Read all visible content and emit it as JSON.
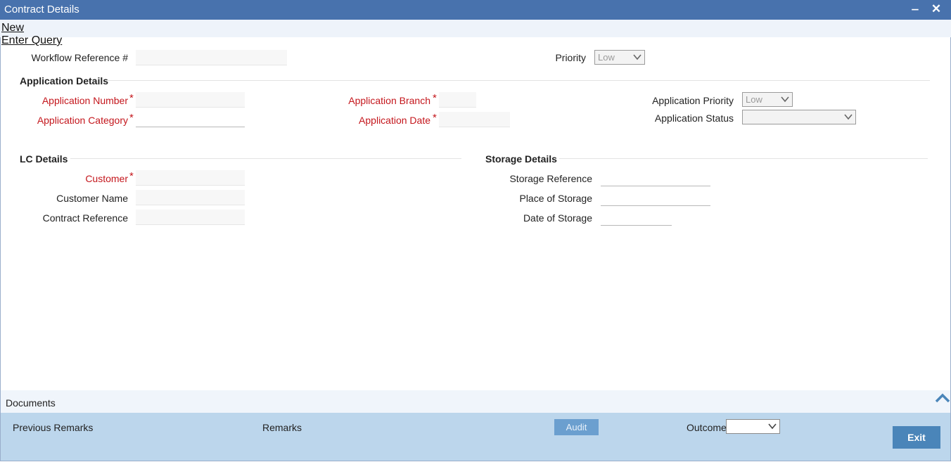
{
  "window": {
    "title": "Contract Details",
    "minimize_glyph": "‒",
    "close_glyph": "✕"
  },
  "menu": {
    "new": "New",
    "enter_query": "Enter Query"
  },
  "header": {
    "workflow_label": "Workflow Reference #",
    "workflow_value": "",
    "priority_label": "Priority",
    "priority_value": "Low"
  },
  "application": {
    "section_title": "Application Details",
    "number_label": "Application Number",
    "category_label": "Application Category",
    "branch_label": "Application Branch",
    "date_label": "Application Date",
    "priority_label": "Application Priority",
    "priority_value": "Low",
    "status_label": "Application Status",
    "status_value": "",
    "required_mark": "*"
  },
  "lc": {
    "section_title": "LC Details",
    "customer_label": "Customer",
    "customer_name_label": "Customer Name",
    "contract_ref_label": "Contract Reference"
  },
  "storage": {
    "section_title": "Storage Details",
    "reference_label": "Storage Reference",
    "place_label": "Place of Storage",
    "date_label": "Date of Storage"
  },
  "footer": {
    "documents_label": "Documents",
    "previous_remarks_label": "Previous Remarks",
    "remarks_label": "Remarks",
    "audit_label": "Audit",
    "outcome_label": "Outcome",
    "outcome_value": "",
    "exit_label": "Exit"
  },
  "colors": {
    "title_bar": "#4872ad",
    "required": "#c4161c",
    "bottom_bar": "#bcd6ec",
    "exit_button": "#4a85b9"
  }
}
